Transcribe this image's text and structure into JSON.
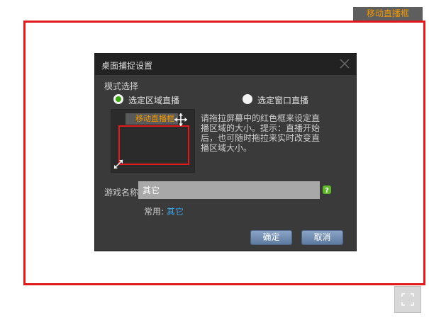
{
  "capture_tab": {
    "label": "移动直播框"
  },
  "dialog": {
    "title": "桌面捕捉设置",
    "mode_label": "模式选择",
    "modes": [
      {
        "label": "选定区域直播",
        "selected": true
      },
      {
        "label": "选定窗口直播",
        "selected": false
      }
    ],
    "preview_tab_label": "移动直播框",
    "hint_lines": [
      "请拖拉屏幕中的红色框来设定直",
      "播区域的大小。提示：直播开始",
      "后，也可随时拖拉来实时改变直",
      "播区域大小。"
    ],
    "game_name_label": "游戏名称",
    "game_name_value": "其它",
    "common_label": "常用:",
    "common_link": "其它",
    "ok_label": "确定",
    "cancel_label": "取消"
  },
  "colors": {
    "frame": "#e01a1a",
    "accent_orange": "#f39800",
    "link": "#41a3e0",
    "radio_selected": "#3ea512",
    "dialog_bg": "#3a3a3a",
    "dialog_header": "#222222"
  },
  "icons": {
    "close": "close-icon",
    "move": "move-icon",
    "resize": "resize-icon",
    "help": "help-icon",
    "fullscreen": "fullscreen-icon"
  }
}
